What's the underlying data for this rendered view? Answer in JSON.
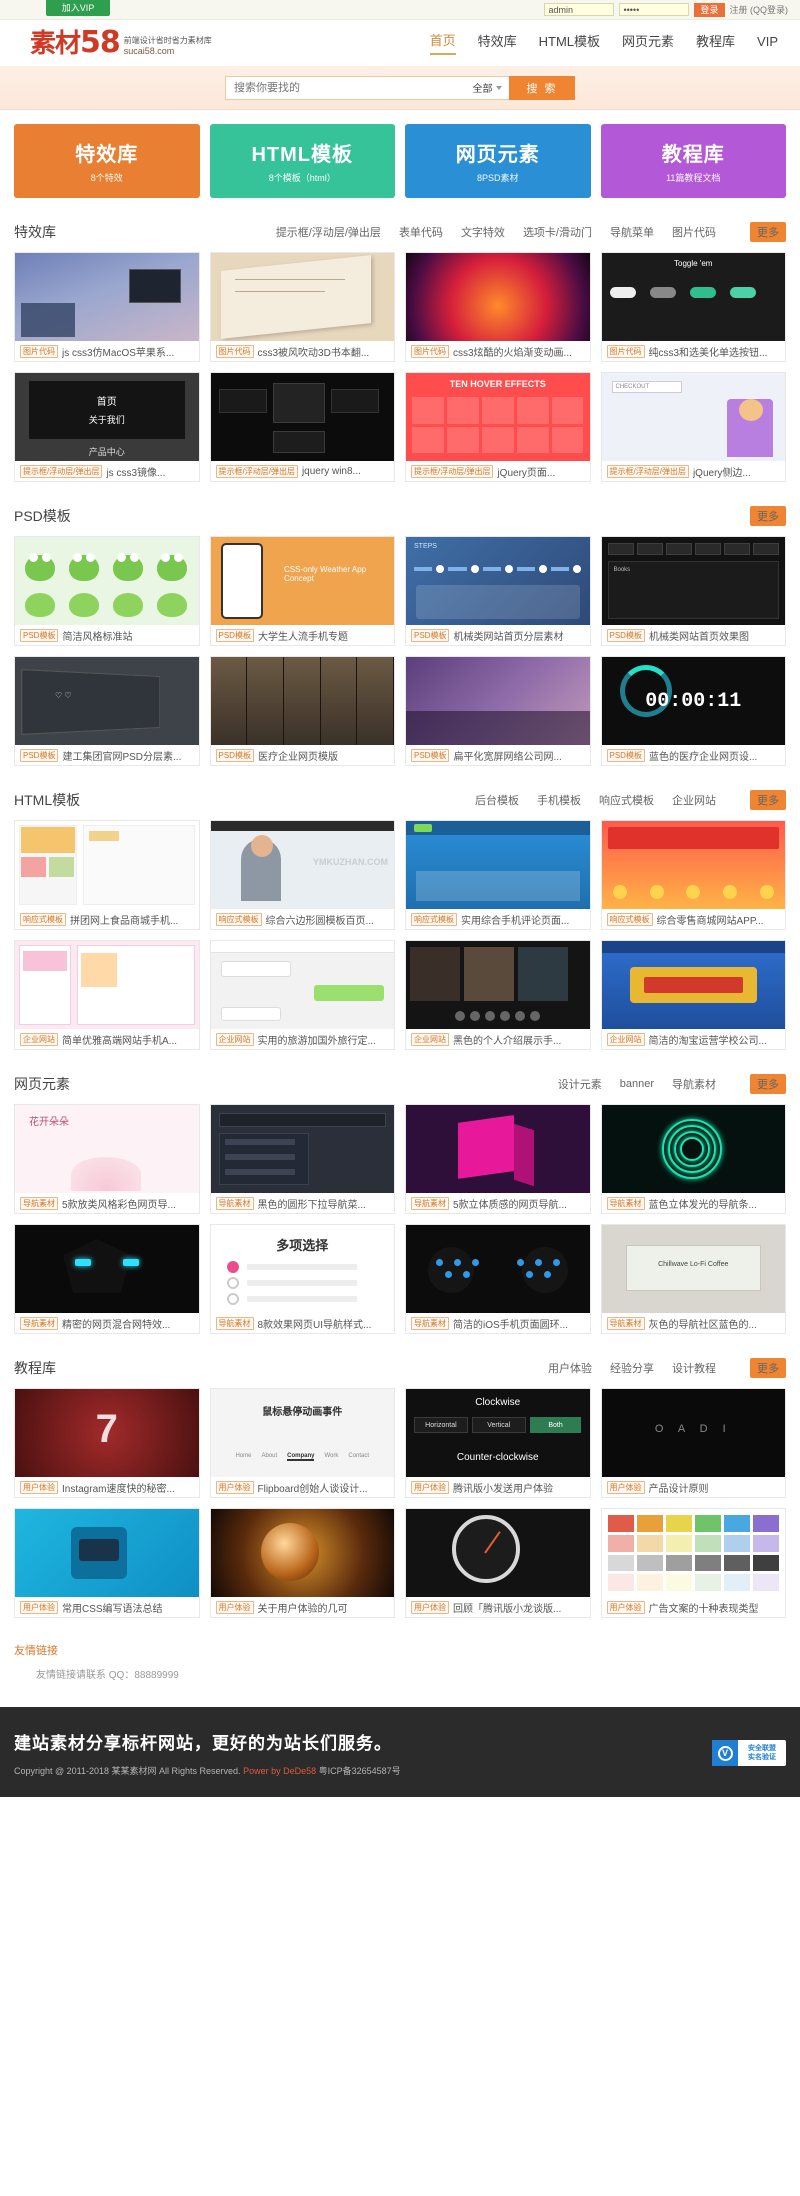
{
  "topbar": {
    "vip_label": "加入VIP",
    "username_value": "admin",
    "password_value": "•••••",
    "login_label": "登录",
    "register_label": "注册 (QQ登录)"
  },
  "header": {
    "logo_text": "素材",
    "logo_number": "58",
    "logo_slogan": "前端设计省时省力素材库",
    "logo_domain": "sucai58.com",
    "nav": [
      {
        "label": "首页",
        "active": true
      },
      {
        "label": "特效库",
        "active": false
      },
      {
        "label": "HTML模板",
        "active": false
      },
      {
        "label": "网页元素",
        "active": false
      },
      {
        "label": "教程库",
        "active": false
      },
      {
        "label": "VIP",
        "active": false
      }
    ]
  },
  "search": {
    "placeholder": "搜索你要找的",
    "scope_label": "全部",
    "button_label": "搜 索"
  },
  "categories": [
    {
      "title": "特效库",
      "sub": "8个特效",
      "color": "#e87f32"
    },
    {
      "title": "HTML模板",
      "sub": "8个模板（html）",
      "color": "#36c39a"
    },
    {
      "title": "网页元素",
      "sub": "8PSD素材",
      "color": "#2a8fd4"
    },
    {
      "title": "教程库",
      "sub": "11篇教程文档",
      "color": "#b358d6"
    }
  ],
  "sections": [
    {
      "title": "特效库",
      "links": [
        "提示框/浮动层/弹出层",
        "表单代码",
        "文字特效",
        "选项卡/滑动门",
        "导航菜单",
        "图片代码"
      ],
      "more": "更多",
      "items": [
        {
          "tag": "图片代码",
          "text": "js css3仿MacOS苹果系...",
          "art": "macos"
        },
        {
          "tag": "图片代码",
          "text": "css3被风吹动3D书本翻...",
          "art": "book"
        },
        {
          "tag": "图片代码",
          "text": "css3炫酷的火焰渐变动画...",
          "art": "fire"
        },
        {
          "tag": "图片代码",
          "text": "纯css3和选美化单选按钮...",
          "art": "toggle"
        },
        {
          "tag": "提示框/浮动层/弹出层",
          "text": "js css3镜像...",
          "art": "darkpage"
        },
        {
          "tag": "提示框/浮动层/弹出层",
          "text": "jquery win8...",
          "art": "cards"
        },
        {
          "tag": "提示框/浮动层/弹出层",
          "text": "jQuery页面...",
          "art": "redgrid"
        },
        {
          "tag": "提示框/浮动层/弹出层",
          "text": "jQuery侧边...",
          "art": "checkout"
        }
      ]
    },
    {
      "title": "PSD模板",
      "links": [],
      "more": "更多",
      "items": [
        {
          "tag": "PSD模板",
          "text": "简洁风格标准站",
          "art": "frogs"
        },
        {
          "tag": "PSD模板",
          "text": "大学生人流手机专题",
          "art": "weather"
        },
        {
          "tag": "PSD模板",
          "text": "机械类网站首页分层素材",
          "art": "steps"
        },
        {
          "tag": "PSD模板",
          "text": "机械类网站首页效果图",
          "art": "table"
        },
        {
          "tag": "PSD模板",
          "text": "建工集团官网PSD分层素...",
          "art": "blackboard"
        },
        {
          "tag": "PSD模板",
          "text": "医疗企业网页模版",
          "art": "cityrow"
        },
        {
          "tag": "PSD模板",
          "text": "扁平化宽屏网络公司网...",
          "art": "purple"
        },
        {
          "tag": "PSD模板",
          "text": "蓝色的医疗企业网页设...",
          "art": "timer",
          "overlay": "00:00:11"
        }
      ]
    },
    {
      "title": "HTML模板",
      "links": [
        "后台模板",
        "手机模板",
        "响应式模板",
        "企业网站"
      ],
      "more": "更多",
      "items": [
        {
          "tag": "响应式模板",
          "text": "拼团网上食品商城手机...",
          "art": "shop"
        },
        {
          "tag": "响应式模板",
          "text": "综合六边形圆模板百页...",
          "art": "person"
        },
        {
          "tag": "响应式模板",
          "text": "实用综合手机评论页面...",
          "art": "bluesite"
        },
        {
          "tag": "响应式模板",
          "text": "综合零售商城网站APP...",
          "art": "promo"
        },
        {
          "tag": "企业网站",
          "text": "简单优雅高端网站手机A...",
          "art": "pink"
        },
        {
          "tag": "企业网站",
          "text": "实用的旅游加国外旅行定...",
          "art": "chat"
        },
        {
          "tag": "企业网站",
          "text": "黑色的个人介绍展示手...",
          "art": "gallery"
        },
        {
          "tag": "企业网站",
          "text": "简洁的淘宝运营学校公司...",
          "art": "festive"
        }
      ]
    },
    {
      "title": "网页元素",
      "links": [
        "设计元素",
        "banner",
        "导航素材"
      ],
      "more": "更多",
      "items": [
        {
          "tag": "导航素材",
          "text": "5款放类风格彩色网页导...",
          "art": "lotus"
        },
        {
          "tag": "导航素材",
          "text": "黑色的圆形下拉导航菜...",
          "art": "darkmenu"
        },
        {
          "tag": "导航素材",
          "text": "5款立体质感的网页导航...",
          "art": "cube"
        },
        {
          "tag": "导航素材",
          "text": "蓝色立体发光的导航条...",
          "art": "neon"
        },
        {
          "tag": "导航素材",
          "text": "精密的网页混合网特效...",
          "art": "robot"
        },
        {
          "tag": "导航素材",
          "text": "8款效果网页UI导航样式...",
          "art": "options"
        },
        {
          "tag": "导航素材",
          "text": "简洁的iOS手机页面圆环...",
          "art": "dots"
        },
        {
          "tag": "导航素材",
          "text": "灰色的导航社区蓝色的...",
          "art": "coffee"
        }
      ]
    },
    {
      "title": "教程库",
      "links": [
        "用户体验",
        "经验分享",
        "设计教程"
      ],
      "more": "更多",
      "items": [
        {
          "tag": "用户体验",
          "text": "Instagram速度快的秘密...",
          "art": "seven"
        },
        {
          "tag": "用户体验",
          "text": "Flipboard创始人谈设计...",
          "art": "mouse"
        },
        {
          "tag": "用户体验",
          "text": "腾讯版小发送用户体验",
          "art": "clockwise"
        },
        {
          "tag": "用户体验",
          "text": "产品设计原则",
          "art": "oadi"
        },
        {
          "tag": "用户体验",
          "text": "常用CSS编写语法总结",
          "art": "carui"
        },
        {
          "tag": "用户体验",
          "text": "关于用户体验的几可",
          "art": "globe"
        },
        {
          "tag": "用户体验",
          "text": "回顾「腾讯版小龙谈版...",
          "art": "gauge"
        },
        {
          "tag": "用户体验",
          "text": "广告文案的十种表现类型",
          "art": "swatches"
        }
      ]
    }
  ],
  "friendly": {
    "title": "友情链接",
    "text": "友情链接请联系 QQ：88889999"
  },
  "footer": {
    "slogan": "建站素材分享标杆网站，更好的为站长们服务。",
    "copyright_pre": "Copyright @ 2011-2018 某某素材网 All Rights Reserved. ",
    "powered_by": "Power by DeDe58",
    "icp": " 粤ICP备32654587号",
    "badge_line1": "安全联盟",
    "badge_line2": "实名验证",
    "badge_mark": "V"
  }
}
